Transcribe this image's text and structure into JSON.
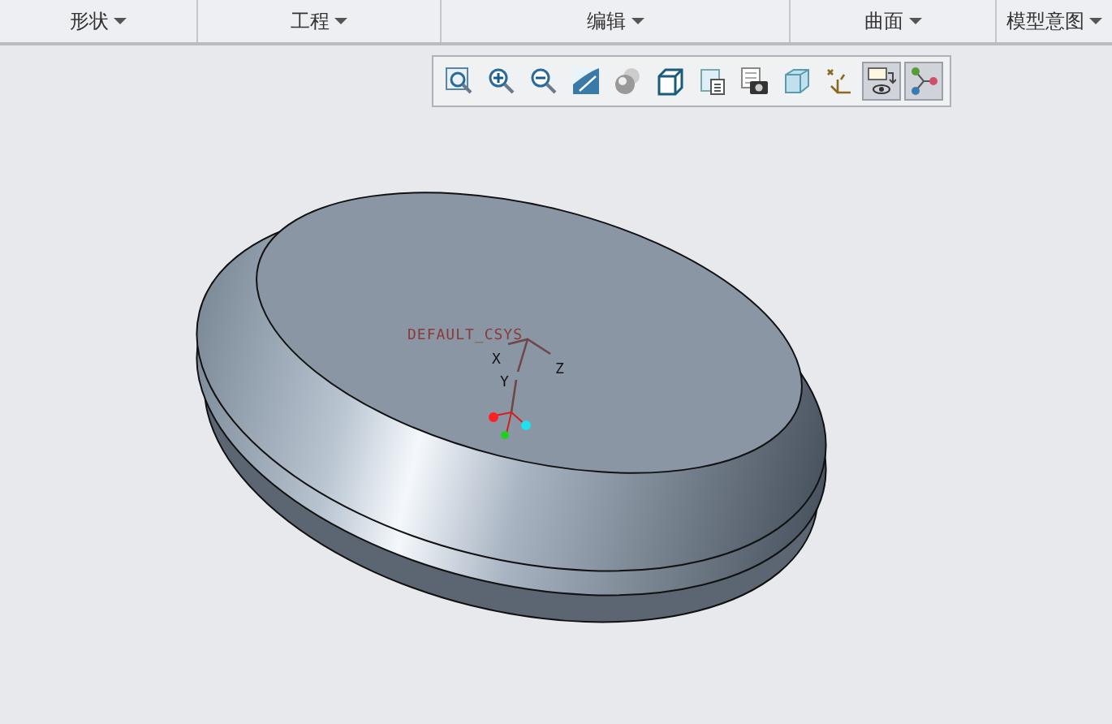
{
  "menu_tabs": [
    {
      "label": "形状"
    },
    {
      "label": "工程"
    },
    {
      "label": "编辑"
    },
    {
      "label": "曲面"
    },
    {
      "label": "模型意图"
    }
  ],
  "toolbar": [
    {
      "kind": "refit",
      "selected": false
    },
    {
      "kind": "zoom-in",
      "selected": false
    },
    {
      "kind": "zoom-out",
      "selected": false
    },
    {
      "kind": "repaint",
      "selected": false
    },
    {
      "kind": "shading",
      "selected": false
    },
    {
      "kind": "cube",
      "selected": false
    },
    {
      "kind": "views",
      "selected": false
    },
    {
      "kind": "camera",
      "selected": false
    },
    {
      "kind": "section",
      "selected": false
    },
    {
      "kind": "datum",
      "selected": false
    },
    {
      "kind": "annotation",
      "selected": true
    },
    {
      "kind": "spin",
      "selected": true
    }
  ],
  "csys": {
    "name": "DEFAULT_CSYS",
    "axes": [
      "X",
      "Y",
      "Z"
    ]
  }
}
